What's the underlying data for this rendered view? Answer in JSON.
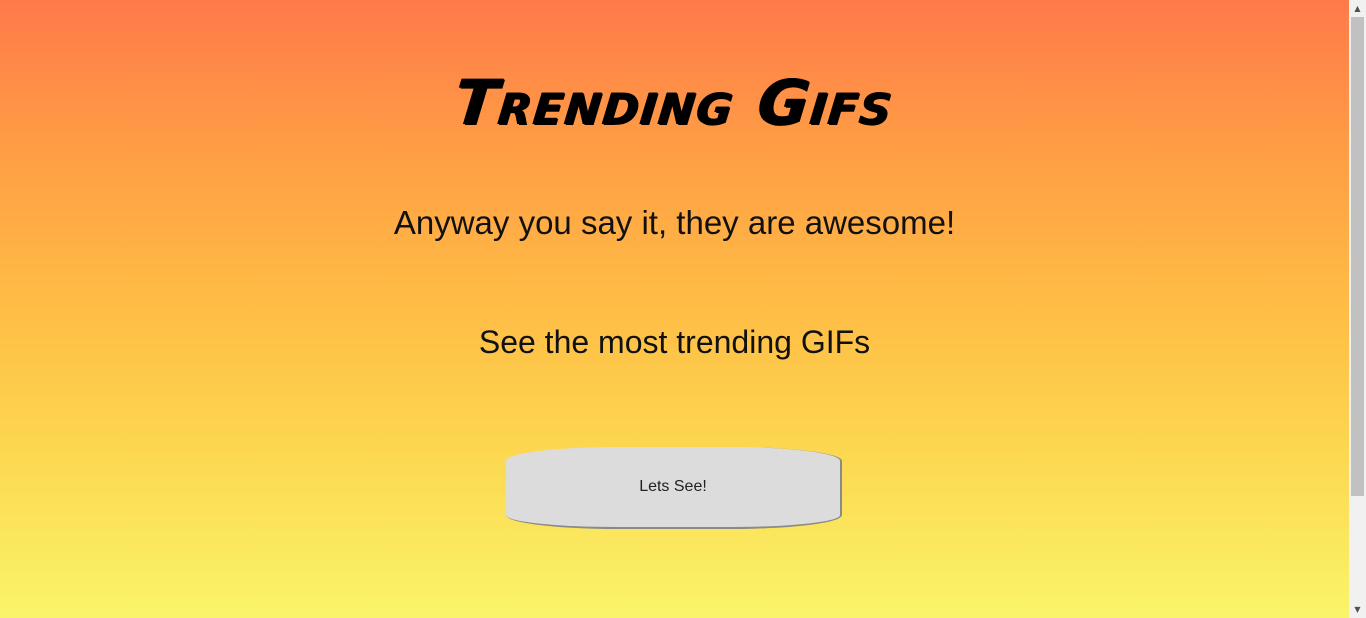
{
  "page": {
    "title": "Trending Gifs",
    "tagline": "Anyway you say it, they are awesome!",
    "subhead": "See the most trending GIFs",
    "cta_label": "Lets See!"
  },
  "scrollbar": {
    "up_icon": "▲",
    "down_icon": "▼"
  },
  "colors": {
    "gradient_top": "#ff7a4a",
    "gradient_bottom": "#f9f56a",
    "button_bg": "#dcdcdc"
  }
}
